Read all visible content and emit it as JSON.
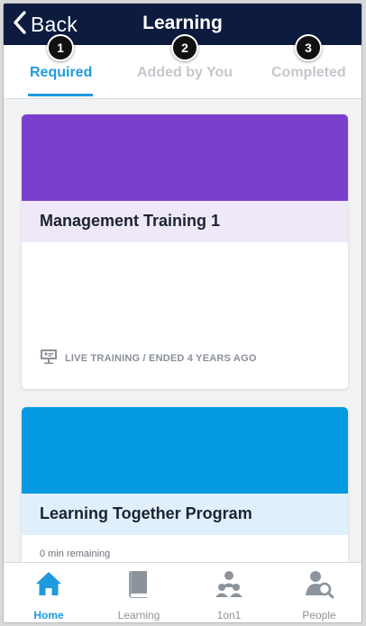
{
  "header": {
    "back_label": "Back",
    "title": "Learning"
  },
  "tabs": [
    {
      "label": "Required",
      "badge": "1",
      "active": true
    },
    {
      "label": "Added by You",
      "badge": "2",
      "active": false
    },
    {
      "label": "Completed",
      "badge": "3",
      "active": false
    }
  ],
  "cards": [
    {
      "title": "Management Training 1",
      "meta": "LIVE TRAINING / ENDED 4 YEARS AGO",
      "banner_color": "#7b3fce",
      "title_bg": "#efe8f8"
    },
    {
      "title": "Learning Together Program",
      "subtitle": "0 min remaining",
      "banner_color": "#049be3",
      "title_bg": "#e0effc"
    }
  ],
  "bottom_nav": [
    {
      "label": "Home",
      "icon": "home-icon",
      "active": true
    },
    {
      "label": "Learning",
      "icon": "book-icon",
      "active": false
    },
    {
      "label": "1on1",
      "icon": "people-pair-icon",
      "active": false
    },
    {
      "label": "People",
      "icon": "people-search-icon",
      "active": false
    }
  ],
  "colors": {
    "header_bg": "#0d1b3e",
    "accent": "#1f9ae0",
    "inactive": "#c4c8ce"
  }
}
